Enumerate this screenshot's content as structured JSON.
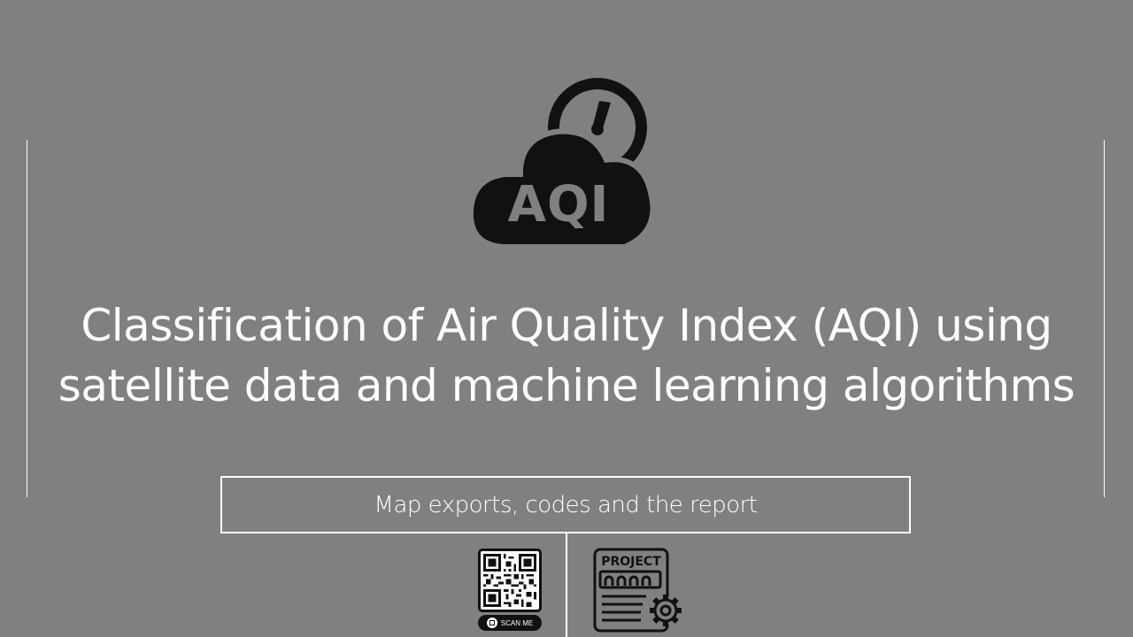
{
  "logo": {
    "text": "AQI",
    "icon": "cloud-gauge-icon"
  },
  "title": {
    "line1": "Classification of Air Quality Index (AQI) using",
    "line2": "satellite data and machine learning algorithms"
  },
  "caption": "Map exports, codes and the report",
  "qr": {
    "label": "SCAN ME",
    "icon": "qr-code-icon"
  },
  "project": {
    "label": "PROJECT",
    "icon": "project-document-gear-icon"
  },
  "colors": {
    "background": "#808080",
    "foreground": "#ffffff",
    "icon": "#111111"
  }
}
